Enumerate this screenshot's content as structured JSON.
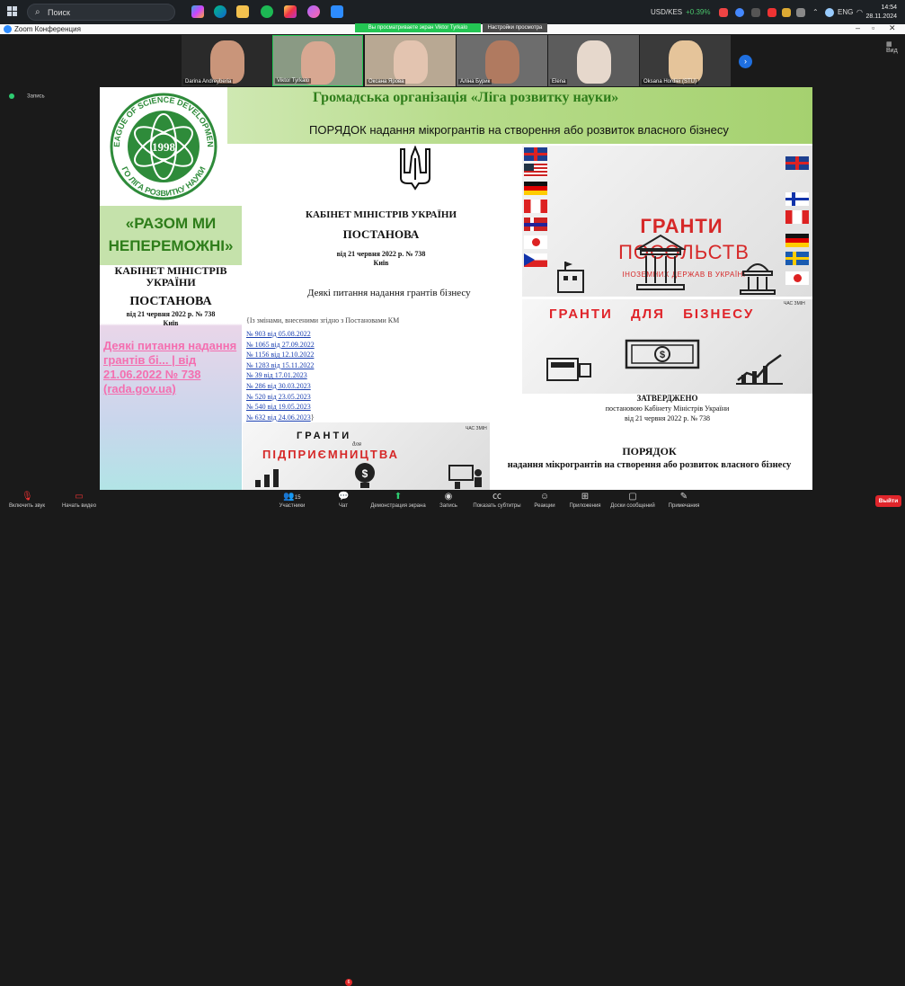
{
  "taskbar": {
    "search_placeholder": "Поиск",
    "ticker": "USD/KES",
    "ticker_change": "+0.39%",
    "lang": "ENG",
    "time": "14:54",
    "date": "28.11.2024"
  },
  "window": {
    "title": "Zoom Конференция",
    "share_banner": "Вы просматриваете экран Viktor Tyrkalo",
    "view_settings": "Настройки просмотра",
    "view_label": "Вид",
    "recording_label": "Запись"
  },
  "participants": [
    {
      "name": "Darina Andreyberia"
    },
    {
      "name": "Viktor Tyrkalo"
    },
    {
      "name": "Оксана Ярова"
    },
    {
      "name": "Аліна Бурик"
    },
    {
      "name": "Elena"
    },
    {
      "name": "Oksana Hordiei (STU)"
    }
  ],
  "slide": {
    "org_title": "Громадська організація «Ліга розвитку науки»",
    "order_title": "ПОРЯДОК надання мікрогрантів  на створення або розвиток власного бізнесу",
    "logo_year": "1998",
    "logo_ring_top": "LEAGUE OF SCIENCE DEVELOPMENT",
    "logo_ring_bottom": "ГО ЛІГА РОЗВИТКУ НАУКИ",
    "slogan": "«РАЗОМ МИ НЕПЕРЕМОЖНІ»",
    "left_doc": {
      "cabinet": "КАБІНЕТ МІНІСТРІВ УКРАЇНИ",
      "post": "ПОСТАНОВА",
      "date": "від 21 червня 2022 р. № 738",
      "city": "Київ",
      "link": "Деякі питання надання грантів бі... | від 21.06.2022 № 738 (rada.gov.ua)"
    },
    "center_doc": {
      "cabinet": "КАБІНЕТ МІНІСТРІВ УКРАЇНИ",
      "post": "ПОСТАНОВА",
      "date": "від 21 червня 2022 р. № 738",
      "city": "Київ",
      "subject": "Деякі питання надання грантів бізнесу",
      "changes_note": "{Із змінами, внесеними згідно з Постановами КМ",
      "amendments": [
        "№ 903 від 05.08.2022",
        "№ 1065 від 27.09.2022",
        "№ 1156 від 12.10.2022",
        "№ 1283 від 15.11.2022",
        "№ 39 від 17.01.2023",
        "№ 286 від 30.03.2023",
        "№ 520 від 23.05.2023",
        "№ 540 від 19.05.2023",
        "№ 632 від 24.06.2023"
      ],
      "closing_brace": "}"
    },
    "embassy_banner": {
      "line1": "ГРАНТИ",
      "line2": "ПОСОЛЬСТВ",
      "line3": "ІНОЗЕМНИХ ДЕРЖАВ В УКРАЇНІ"
    },
    "business_banner": {
      "title": "ГРАНТИ ДЛЯ БІЗНЕСУ",
      "brand": "ЧАС ЗМІН"
    },
    "entrepreneur_banner": {
      "line1": "ГРАНТИ",
      "line2": "для",
      "line3": "ПІДПРИЄМНИЦТВА",
      "brand": "ЧАС ЗМІН"
    },
    "approved": {
      "title": "ЗАТВЕРДЖЕНО",
      "line1": "постановою Кабінету Міністрів України",
      "line2": "від 21 червня 2022 р. № 738"
    },
    "order_block": {
      "title": "ПОРЯДОК",
      "subtitle": "надання мікрогрантів на створення або розвиток власного бізнесу"
    }
  },
  "toolbar": {
    "mute": "Включить звук",
    "video": "Начать видео",
    "participants": "Участники",
    "participants_count": "15",
    "chat": "Чат",
    "chat_badge": "6",
    "share": "Демонстрация экрана",
    "record": "Запись",
    "captions": "Показать субтитры",
    "reactions": "Реакции",
    "apps": "Приложения",
    "whiteboards": "Доски сообщений",
    "notes": "Примечания",
    "leave": "Выйти"
  },
  "colors": {
    "zoom_green": "#23c553",
    "leave_red": "#e0252b",
    "slide_green": "#2e7d1a",
    "banner_red": "#d62828"
  }
}
